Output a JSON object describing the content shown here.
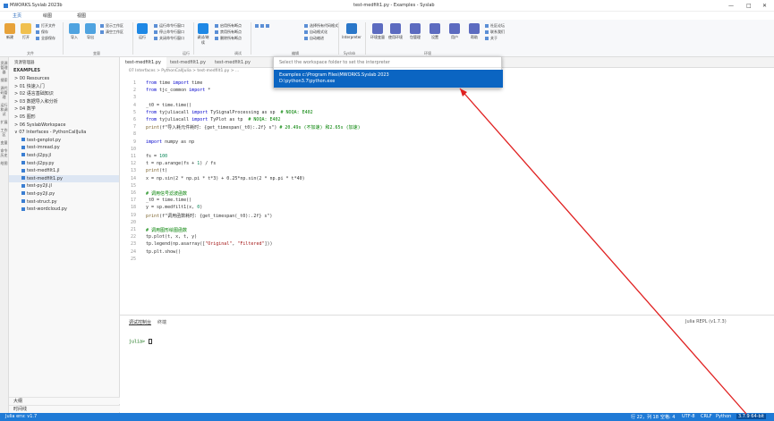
{
  "window": {
    "app_title": "MWORKS.Syslab 2023b",
    "title": "test-medfilt1.py - Examples - Syslab",
    "controls": [
      "—",
      "□",
      "✕"
    ]
  },
  "menu": [
    "主页",
    "绘图",
    "视图"
  ],
  "ribbon": {
    "file": {
      "new": "新建",
      "open": "打开",
      "open_file": "打开文件",
      "save": "保存",
      "save_all": "全部保存",
      "group": "文件"
    },
    "vars": {
      "import": "导入",
      "export": "导出",
      "open_ws": "显示工作区",
      "clear_ws": "清空工作区",
      "group": "变量"
    },
    "run": {
      "run": "运行",
      "opts": [
        "运行命令行窗口",
        "停止命令行窗口",
        "关闭命令行窗口"
      ],
      "group": "运行"
    },
    "debug": {
      "debug": "调试/继续",
      "opts": [
        "启用所有断点",
        "禁用所有断点",
        "删除所有断点"
      ],
      "group": "调试"
    },
    "code": {
      "opts": [
        "选择所有代码格式",
        "自动格式化",
        "自动缩进"
      ],
      "group": "编辑"
    },
    "interp": {
      "label": "Interpreter",
      "group": "Syslab"
    },
    "env": {
      "items": [
        "环境变量",
        "使用环境",
        "包管理",
        "设置",
        "用户",
        "帮助"
      ],
      "opts": [
        "社区论坛",
        "联系我们",
        "关于"
      ],
      "group": "环境"
    }
  },
  "leftstrip": [
    "资源管理器",
    "搜索",
    "源代码管理",
    "运行和调试",
    "扩展",
    "工作区",
    "变量",
    "命令历史",
    "绘图"
  ],
  "explorer": {
    "header": "资源管理器",
    "root": "EXAMPLES",
    "items": [
      {
        "label": "00 Resources",
        "type": "folder"
      },
      {
        "label": "01 快速入门",
        "type": "folder"
      },
      {
        "label": "02 语言基础知识",
        "type": "folder"
      },
      {
        "label": "03 数据导入和分析",
        "type": "folder"
      },
      {
        "label": "04 数学",
        "type": "folder"
      },
      {
        "label": "05 图形",
        "type": "folder"
      },
      {
        "label": "06 SyslabWorkspace",
        "type": "folder"
      },
      {
        "label": "07 Interfaces - PythonCallJulia",
        "type": "folder-open"
      },
      {
        "label": "test-genplot.py",
        "type": "file"
      },
      {
        "label": "test-imread.py",
        "type": "file"
      },
      {
        "label": "test-jl2py.jl",
        "type": "file"
      },
      {
        "label": "test-jl2py.py",
        "type": "file"
      },
      {
        "label": "test-medfilt1.jl",
        "type": "file"
      },
      {
        "label": "test-medfilt1.py",
        "type": "file",
        "selected": true
      },
      {
        "label": "test-py2jl.jl",
        "type": "file"
      },
      {
        "label": "test-py2jl.py",
        "type": "file"
      },
      {
        "label": "test-struct.py",
        "type": "file"
      },
      {
        "label": "test-wordcloud.py",
        "type": "file"
      }
    ],
    "outline": "大纲",
    "timeline": "时间线"
  },
  "tabs": [
    {
      "label": "test-medfilt1.py",
      "active": true
    },
    {
      "label": "test-medfilt1.py"
    },
    {
      "label": "test-medfilt1.py"
    }
  ],
  "breadcrumb": "07 Interfaces > PythonCallJulia > test-medfilt1.py > ...",
  "editor": {
    "lines": [
      [
        {
          "t": "from",
          "c": "kw"
        },
        {
          "t": " time ",
          "c": ""
        },
        {
          "t": "import",
          "c": "kw"
        },
        {
          "t": " time",
          "c": ""
        }
      ],
      [
        {
          "t": "from",
          "c": "kw"
        },
        {
          "t": " tjc_common ",
          "c": ""
        },
        {
          "t": "import",
          "c": "kw"
        },
        {
          "t": " *",
          "c": ""
        }
      ],
      [],
      [
        {
          "t": "_t0 = time.time()",
          "c": ""
        }
      ],
      [
        {
          "t": "from",
          "c": "kw"
        },
        {
          "t": " tyjuliacall ",
          "c": ""
        },
        {
          "t": "import",
          "c": "kw"
        },
        {
          "t": " TySignalProcessing as sp  ",
          "c": ""
        },
        {
          "t": "# NOQA: E402",
          "c": "cm"
        }
      ],
      [
        {
          "t": "from",
          "c": "kw"
        },
        {
          "t": " tyjuliacall ",
          "c": ""
        },
        {
          "t": "import",
          "c": "kw"
        },
        {
          "t": " TyPlot as tp  ",
          "c": ""
        },
        {
          "t": "# NOQA: E402",
          "c": "cm"
        }
      ],
      [
        {
          "t": "print",
          "c": "fn"
        },
        {
          "t": "(f\"导入耗元件耗时: {get_timespan(_t0):.2f} s\") ",
          "c": ""
        },
        {
          "t": "# 20.49s (不加速) 和2.65s (加速)",
          "c": "cm"
        }
      ],
      [],
      [
        {
          "t": "import",
          "c": "kw"
        },
        {
          "t": " numpy as np",
          "c": ""
        }
      ],
      [],
      [
        {
          "t": "fs = ",
          "c": ""
        },
        {
          "t": "100",
          "c": "num"
        }
      ],
      [
        {
          "t": "t = np.arange(fs + ",
          "c": ""
        },
        {
          "t": "1",
          "c": "num"
        },
        {
          "t": ") / fs",
          "c": ""
        }
      ],
      [
        {
          "t": "print",
          "c": "fn"
        },
        {
          "t": "(t)",
          "c": ""
        }
      ],
      [
        {
          "t": "x = np.sin(2 * np.pi * t*3) + 0.25*np.sin(2 * np.pi * t*40)",
          "c": ""
        }
      ],
      [],
      [
        {
          "t": "# 调用信号滤波函数",
          "c": "cm"
        }
      ],
      [
        {
          "t": "_t0 = time.time()",
          "c": ""
        }
      ],
      [
        {
          "t": "y = sp.medfilt1(x, ",
          "c": ""
        },
        {
          "t": "0",
          "c": "num"
        },
        {
          "t": ")",
          "c": ""
        }
      ],
      [
        {
          "t": "print",
          "c": "fn"
        },
        {
          "t": "(f\"调用函数耗时: {get_timespan(_t0):.2f} s\")",
          "c": ""
        }
      ],
      [],
      [
        {
          "t": "# 调用图形绘图函数",
          "c": "cm"
        }
      ],
      [
        {
          "t": "tp.plot(t, x, t, y)",
          "c": ""
        }
      ],
      [
        {
          "t": "tp.legend(np.asarray([",
          "c": ""
        },
        {
          "t": "\"Original\"",
          "c": "str"
        },
        {
          "t": ", ",
          "c": ""
        },
        {
          "t": "\"Filtered\"",
          "c": "str"
        },
        {
          "t": "]))",
          "c": ""
        }
      ],
      [
        {
          "t": "tp.plt.show()",
          "c": ""
        }
      ],
      []
    ]
  },
  "picker": {
    "placeholder": "Select the workspace folder to set the interpreter",
    "option_title": "Examples  c:\\Program Files\\MWORKS.Syslab 2023",
    "option_sub": "D:\\python3.7\\python.exe"
  },
  "panel": {
    "tabs": [
      "调试控制台",
      "终端"
    ],
    "repl": "Julia REPL (v1.7.3)",
    "prompt": "julia>"
  },
  "status": {
    "left": "Julia env: v1.7",
    "right": [
      "行 22，列 18",
      "空格: 4",
      "UTF-8",
      "CRLF",
      "Python",
      "3.7.9 64-bit"
    ]
  }
}
